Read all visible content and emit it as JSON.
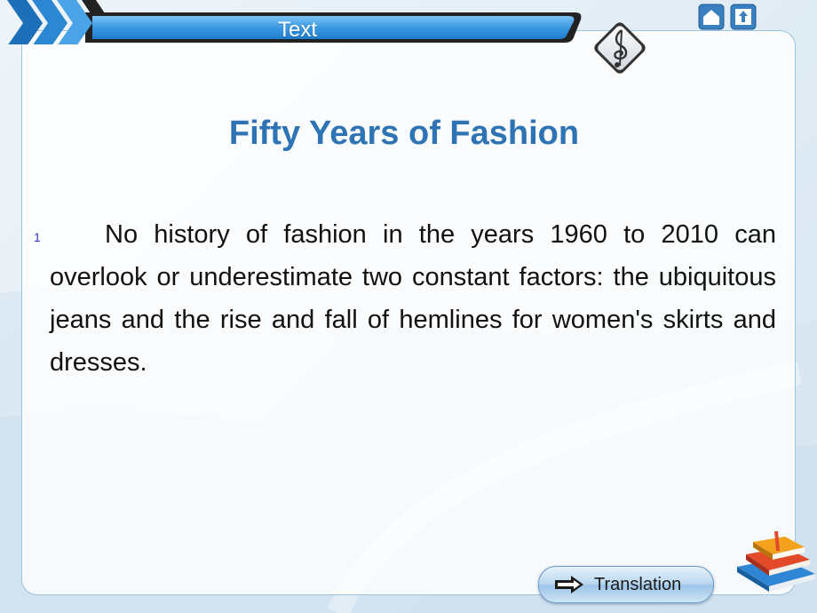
{
  "header": {
    "title": "Text"
  },
  "icons": {
    "music": "music-note-icon",
    "home": "home-icon",
    "up": "up-arrow-icon",
    "translation_arrow": "arrow-right-icon",
    "books": "books-icon"
  },
  "main": {
    "title": "Fifty Years of Fashion",
    "paragraph_number": "1",
    "paragraph": "No history of fashion in the years 1960 to 2010 can overlook or underestimate two constant factors: the ubiquitous jeans and the rise and fall of hemlines for women's skirts and dresses."
  },
  "footer": {
    "translation_label": "Translation"
  },
  "colors": {
    "title": "#2e74b5",
    "header_bar": "#2f8fd8",
    "panel_border": "#9cc3e0"
  }
}
